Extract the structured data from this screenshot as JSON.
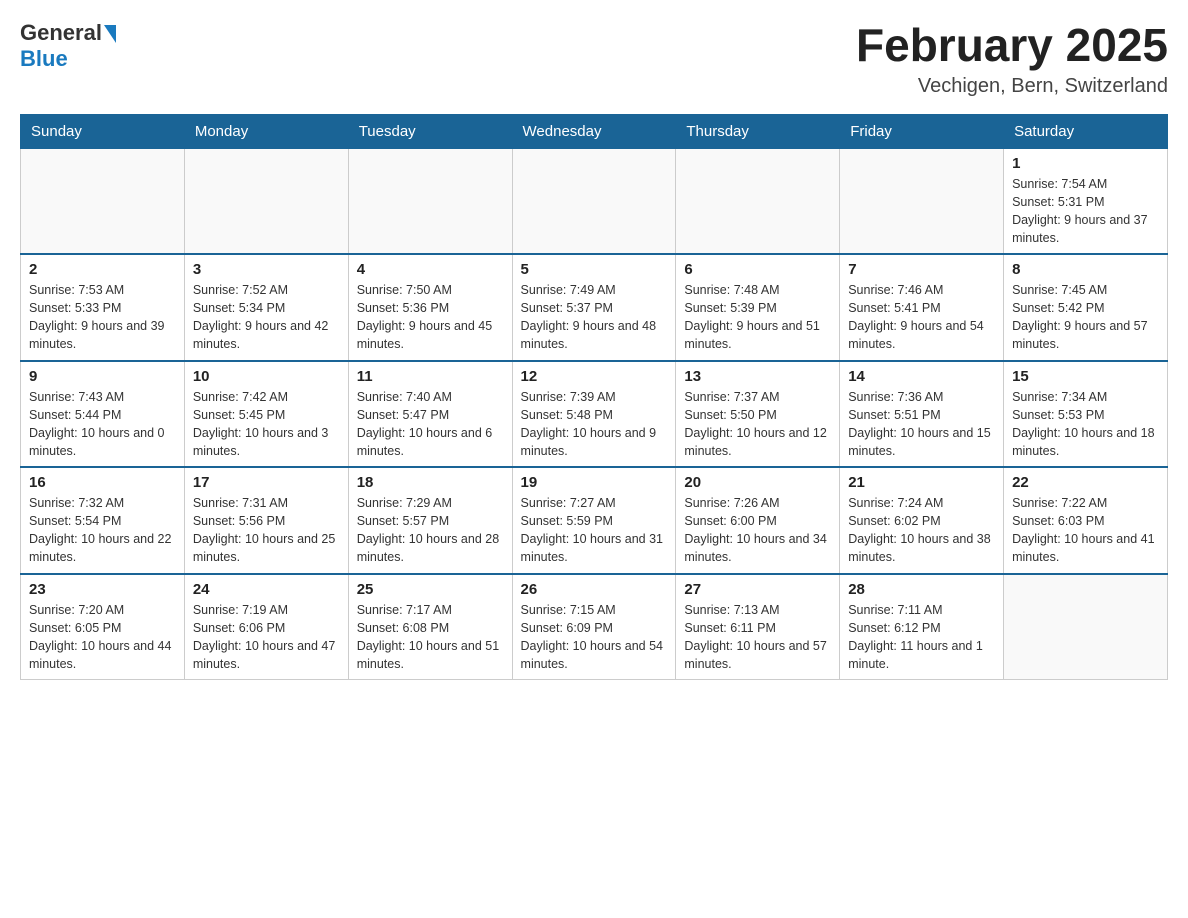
{
  "header": {
    "logo_general": "General",
    "logo_blue": "Blue",
    "title": "February 2025",
    "subtitle": "Vechigen, Bern, Switzerland"
  },
  "weekdays": [
    "Sunday",
    "Monday",
    "Tuesday",
    "Wednesday",
    "Thursday",
    "Friday",
    "Saturday"
  ],
  "weeks": [
    [
      {
        "day": "",
        "info": ""
      },
      {
        "day": "",
        "info": ""
      },
      {
        "day": "",
        "info": ""
      },
      {
        "day": "",
        "info": ""
      },
      {
        "day": "",
        "info": ""
      },
      {
        "day": "",
        "info": ""
      },
      {
        "day": "1",
        "info": "Sunrise: 7:54 AM\nSunset: 5:31 PM\nDaylight: 9 hours and 37 minutes."
      }
    ],
    [
      {
        "day": "2",
        "info": "Sunrise: 7:53 AM\nSunset: 5:33 PM\nDaylight: 9 hours and 39 minutes."
      },
      {
        "day": "3",
        "info": "Sunrise: 7:52 AM\nSunset: 5:34 PM\nDaylight: 9 hours and 42 minutes."
      },
      {
        "day": "4",
        "info": "Sunrise: 7:50 AM\nSunset: 5:36 PM\nDaylight: 9 hours and 45 minutes."
      },
      {
        "day": "5",
        "info": "Sunrise: 7:49 AM\nSunset: 5:37 PM\nDaylight: 9 hours and 48 minutes."
      },
      {
        "day": "6",
        "info": "Sunrise: 7:48 AM\nSunset: 5:39 PM\nDaylight: 9 hours and 51 minutes."
      },
      {
        "day": "7",
        "info": "Sunrise: 7:46 AM\nSunset: 5:41 PM\nDaylight: 9 hours and 54 minutes."
      },
      {
        "day": "8",
        "info": "Sunrise: 7:45 AM\nSunset: 5:42 PM\nDaylight: 9 hours and 57 minutes."
      }
    ],
    [
      {
        "day": "9",
        "info": "Sunrise: 7:43 AM\nSunset: 5:44 PM\nDaylight: 10 hours and 0 minutes."
      },
      {
        "day": "10",
        "info": "Sunrise: 7:42 AM\nSunset: 5:45 PM\nDaylight: 10 hours and 3 minutes."
      },
      {
        "day": "11",
        "info": "Sunrise: 7:40 AM\nSunset: 5:47 PM\nDaylight: 10 hours and 6 minutes."
      },
      {
        "day": "12",
        "info": "Sunrise: 7:39 AM\nSunset: 5:48 PM\nDaylight: 10 hours and 9 minutes."
      },
      {
        "day": "13",
        "info": "Sunrise: 7:37 AM\nSunset: 5:50 PM\nDaylight: 10 hours and 12 minutes."
      },
      {
        "day": "14",
        "info": "Sunrise: 7:36 AM\nSunset: 5:51 PM\nDaylight: 10 hours and 15 minutes."
      },
      {
        "day": "15",
        "info": "Sunrise: 7:34 AM\nSunset: 5:53 PM\nDaylight: 10 hours and 18 minutes."
      }
    ],
    [
      {
        "day": "16",
        "info": "Sunrise: 7:32 AM\nSunset: 5:54 PM\nDaylight: 10 hours and 22 minutes."
      },
      {
        "day": "17",
        "info": "Sunrise: 7:31 AM\nSunset: 5:56 PM\nDaylight: 10 hours and 25 minutes."
      },
      {
        "day": "18",
        "info": "Sunrise: 7:29 AM\nSunset: 5:57 PM\nDaylight: 10 hours and 28 minutes."
      },
      {
        "day": "19",
        "info": "Sunrise: 7:27 AM\nSunset: 5:59 PM\nDaylight: 10 hours and 31 minutes."
      },
      {
        "day": "20",
        "info": "Sunrise: 7:26 AM\nSunset: 6:00 PM\nDaylight: 10 hours and 34 minutes."
      },
      {
        "day": "21",
        "info": "Sunrise: 7:24 AM\nSunset: 6:02 PM\nDaylight: 10 hours and 38 minutes."
      },
      {
        "day": "22",
        "info": "Sunrise: 7:22 AM\nSunset: 6:03 PM\nDaylight: 10 hours and 41 minutes."
      }
    ],
    [
      {
        "day": "23",
        "info": "Sunrise: 7:20 AM\nSunset: 6:05 PM\nDaylight: 10 hours and 44 minutes."
      },
      {
        "day": "24",
        "info": "Sunrise: 7:19 AM\nSunset: 6:06 PM\nDaylight: 10 hours and 47 minutes."
      },
      {
        "day": "25",
        "info": "Sunrise: 7:17 AM\nSunset: 6:08 PM\nDaylight: 10 hours and 51 minutes."
      },
      {
        "day": "26",
        "info": "Sunrise: 7:15 AM\nSunset: 6:09 PM\nDaylight: 10 hours and 54 minutes."
      },
      {
        "day": "27",
        "info": "Sunrise: 7:13 AM\nSunset: 6:11 PM\nDaylight: 10 hours and 57 minutes."
      },
      {
        "day": "28",
        "info": "Sunrise: 7:11 AM\nSunset: 6:12 PM\nDaylight: 11 hours and 1 minute."
      },
      {
        "day": "",
        "info": ""
      }
    ]
  ]
}
